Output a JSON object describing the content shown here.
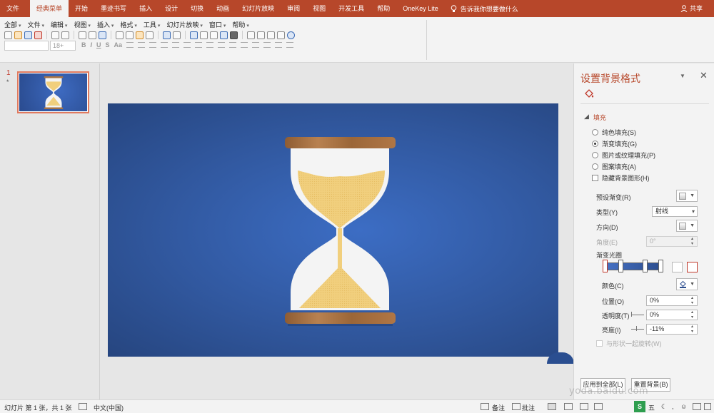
{
  "ribbon": {
    "tabs": [
      "文件",
      "经典菜单",
      "开始",
      "墨迹书写",
      "插入",
      "设计",
      "切换",
      "动画",
      "幻灯片放映",
      "审阅",
      "视图",
      "开发工具",
      "帮助",
      "OneKey Lite"
    ],
    "active_tab": "经典菜单",
    "tell_me": "告诉我你想要做什么",
    "share": "共享",
    "accent_color": "#b7472a"
  },
  "toolbar": {
    "menus": [
      "全部",
      "文件",
      "编辑",
      "视图",
      "插入",
      "格式",
      "工具",
      "幻灯片放映",
      "窗口",
      "帮助"
    ],
    "font_size_placeholder": "18+",
    "format_letters": [
      "B",
      "I",
      "U",
      "S",
      "Aa"
    ]
  },
  "thumbnails": {
    "slide_number": "1",
    "marker": "*"
  },
  "format_pane": {
    "title": "设置背景格式",
    "section": "填充",
    "fill_options": [
      {
        "label": "纯色填充(S)",
        "selected": false
      },
      {
        "label": "渐变填充(G)",
        "selected": true
      },
      {
        "label": "图片或纹理填充(P)",
        "selected": false
      },
      {
        "label": "图案填充(A)",
        "selected": false
      }
    ],
    "hide_bg_graphics": "隐藏背景图形(H)",
    "preset_gradient": "预设渐变(R)",
    "type_label": "类型(Y)",
    "type_value": "射线",
    "direction_label": "方向(D)",
    "angle_label": "角度(E)",
    "angle_value": "0°",
    "gradient_stops_label": "渐变光圈",
    "color_label": "颜色(C)",
    "position_label": "位置(O)",
    "position_value": "0%",
    "transparency_label": "透明度(T)",
    "transparency_value": "0%",
    "brightness_label": "亮度(I)",
    "brightness_value": "-11%",
    "rotate_with_shape": "与形状一起旋转(W)",
    "apply_all": "应用到全部(L)",
    "reset_bg": "重置背景(B)"
  },
  "statusbar": {
    "slide_info": "幻灯片 第 1 张，共 1 张",
    "language": "中文(中国)",
    "notes": "备注",
    "comments": "批注"
  },
  "watermark": "yoda.baidu.com"
}
